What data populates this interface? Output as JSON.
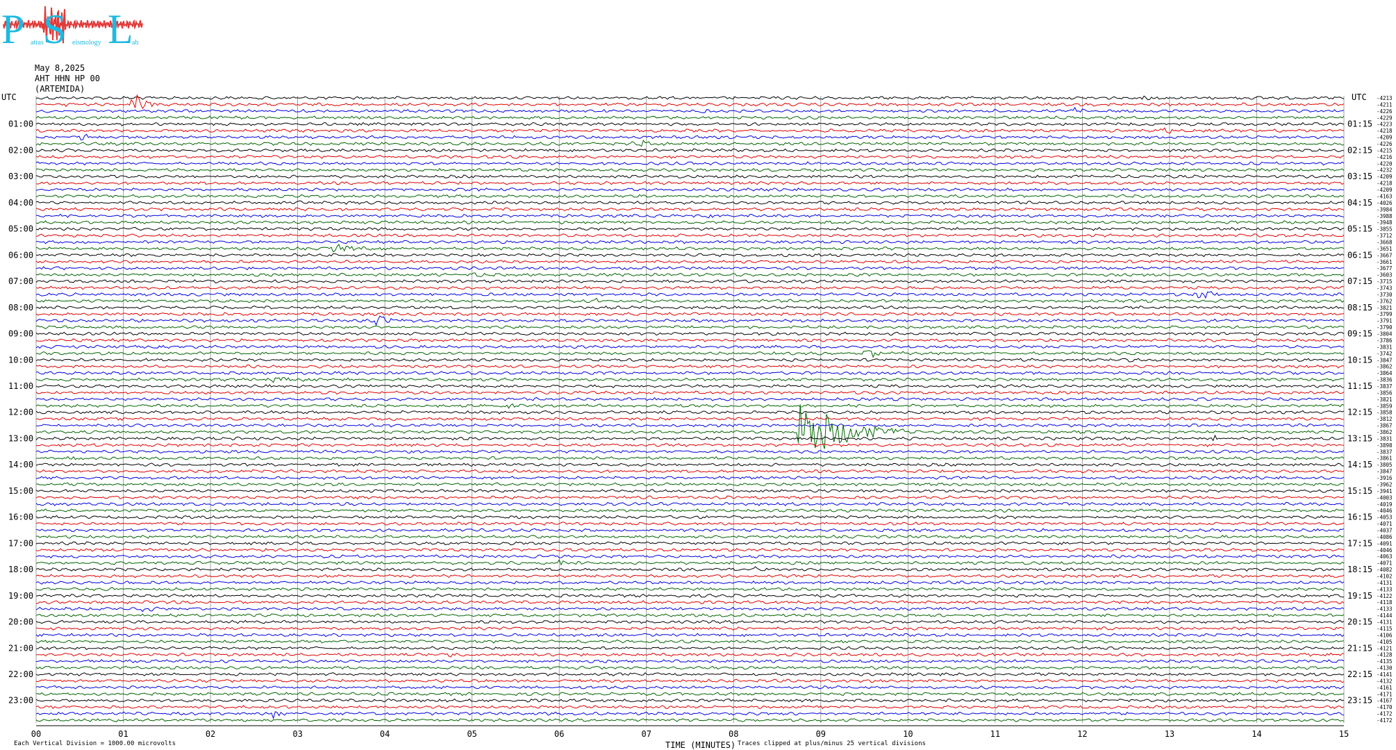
{
  "logo": {
    "letters": [
      "P",
      "S",
      "L"
    ],
    "subtext_1": "atras",
    "subtext_2": "eismology",
    "subtext_3": "ab",
    "colors": {
      "letters": "#1fb9e0",
      "wave": "#e23a3a"
    }
  },
  "header": {
    "date": "May 8,2025",
    "station": "AHT HHN HP 00",
    "location": "(ARTEMIDA)"
  },
  "chart_data": {
    "type": "helicorder",
    "left_axis_title": "UTC",
    "right_axis_title": "UTC",
    "left_hour_labels": [
      "01:00",
      "02:00",
      "03:00",
      "04:00",
      "05:00",
      "06:00",
      "07:00",
      "08:00",
      "09:00",
      "10:00",
      "11:00",
      "12:00",
      "13:00",
      "14:00",
      "15:00",
      "16:00",
      "17:00",
      "18:00",
      "19:00",
      "20:00",
      "21:00",
      "22:00",
      "23:00"
    ],
    "right_hour_labels": [
      "01:15",
      "02:15",
      "03:15",
      "04:15",
      "05:15",
      "06:15",
      "07:15",
      "08:15",
      "09:15",
      "10:15",
      "11:15",
      "12:15",
      "13:15",
      "14:15",
      "15:15",
      "16:15",
      "17:15",
      "18:15",
      "19:15",
      "20:15",
      "21:15",
      "22:15",
      "23:15"
    ],
    "x_ticks": [
      "00",
      "01",
      "02",
      "03",
      "04",
      "05",
      "06",
      "07",
      "08",
      "09",
      "10",
      "11",
      "12",
      "13",
      "14",
      "15"
    ],
    "xlabel": "TIME (MINUTES)",
    "xlim": [
      0,
      15
    ],
    "trace_colors": [
      "#000000",
      "#e00000",
      "#0000e0",
      "#006400"
    ],
    "trace_count": 96,
    "right_trace_values": [
      "-4213",
      "-4211",
      "-4226",
      "-4229",
      "-4223",
      "-4218",
      "-4209",
      "-4226",
      "-4215",
      "-4216",
      "-4220",
      "-4232",
      "-4209",
      "-4218",
      "-4209",
      "-4163",
      "-4026",
      "-3984",
      "-3988",
      "-3948",
      "-3855",
      "-3712",
      "-3668",
      "-3651",
      "-3667",
      "-3661",
      "-3677",
      "-3603",
      "-3715",
      "-3743",
      "-3730",
      "-3762",
      "-3821",
      "-3799",
      "-3791",
      "-3790",
      "-3804",
      "-3786",
      "-3831",
      "-3742",
      "-3847",
      "-3862",
      "-3864",
      "-3836",
      "-3837",
      "-3856",
      "-3821",
      "-3859",
      "-3858",
      "-3812",
      "-3867",
      "-3862",
      "-3831",
      "-3898",
      "-3837",
      "-3861",
      "-3805",
      "-3847",
      "-3916",
      "-3962",
      "-3941",
      "-4003",
      "-4019",
      "-4046",
      "-4053",
      "-4071",
      "-4037",
      "-4086",
      "-4091",
      "-4046",
      "-4063",
      "-4071",
      "-4082",
      "-4102",
      "-4131",
      "-4133",
      "-4122",
      "-4118",
      "-4133",
      "-4144",
      "-4131",
      "-4115",
      "-4106",
      "-4105",
      "-4121",
      "-4128",
      "-4135",
      "-4130",
      "-4141",
      "-4132",
      "-4161",
      "-4171",
      "-4167",
      "-4170",
      "-4172",
      "-4172"
    ],
    "events": [
      {
        "trace": 1,
        "minute": 1.1,
        "amp": 20,
        "dur": 0.3
      },
      {
        "trace": 1,
        "minute": 0.3,
        "amp": 5,
        "dur": 0.2
      },
      {
        "trace": 2,
        "minute": 7.65,
        "amp": 6,
        "dur": 0.15
      },
      {
        "trace": 2,
        "minute": 11.9,
        "amp": 6,
        "dur": 0.25
      },
      {
        "trace": 0,
        "minute": 12.7,
        "amp": 4,
        "dur": 0.3
      },
      {
        "trace": 5,
        "minute": 12.9,
        "amp": 7,
        "dur": 0.4
      },
      {
        "trace": 6,
        "minute": 0.5,
        "amp": 6,
        "dur": 0.3
      },
      {
        "trace": 7,
        "minute": 6.8,
        "amp": 6,
        "dur": 0.8
      },
      {
        "trace": 16,
        "minute": 3.0,
        "amp": 4,
        "dur": 0.4
      },
      {
        "trace": 18,
        "minute": 7.7,
        "amp": 5,
        "dur": 0.2
      },
      {
        "trace": 23,
        "minute": 3.4,
        "amp": 8,
        "dur": 0.5
      },
      {
        "trace": 27,
        "minute": 5.0,
        "amp": 7,
        "dur": 0.2
      },
      {
        "trace": 30,
        "minute": 13.3,
        "amp": 9,
        "dur": 0.5
      },
      {
        "trace": 31,
        "minute": 6.4,
        "amp": 4,
        "dur": 0.2
      },
      {
        "trace": 34,
        "minute": 3.9,
        "amp": 8,
        "dur": 0.5
      },
      {
        "trace": 39,
        "minute": 9.5,
        "amp": 7,
        "dur": 0.5
      },
      {
        "trace": 40,
        "minute": 12.5,
        "amp": 6,
        "dur": 0.2
      },
      {
        "trace": 43,
        "minute": 2.7,
        "amp": 8,
        "dur": 0.6
      },
      {
        "trace": 47,
        "minute": 5.4,
        "amp": 4,
        "dur": 0.3
      },
      {
        "trace": 51,
        "minute": 8.75,
        "amp": 55,
        "dur": 1.2
      },
      {
        "trace": 52,
        "minute": 13.5,
        "amp": 6,
        "dur": 0.2
      },
      {
        "trace": 55,
        "minute": 0.3,
        "amp": 4,
        "dur": 0.6
      },
      {
        "trace": 71,
        "minute": 6.0,
        "amp": 6,
        "dur": 0.5
      },
      {
        "trace": 72,
        "minute": 8.2,
        "amp": 4,
        "dur": 0.3
      },
      {
        "trace": 78,
        "minute": 1.2,
        "amp": 4,
        "dur": 0.6
      },
      {
        "trace": 85,
        "minute": 4.7,
        "amp": 4,
        "dur": 0.3
      },
      {
        "trace": 94,
        "minute": 2.7,
        "amp": 9,
        "dur": 0.3
      }
    ]
  },
  "footer": {
    "left_note": "Each Vertical Division = 1000.00 microvolts",
    "right_note": "Traces clipped at plus/minus 25 vertical divisions"
  }
}
